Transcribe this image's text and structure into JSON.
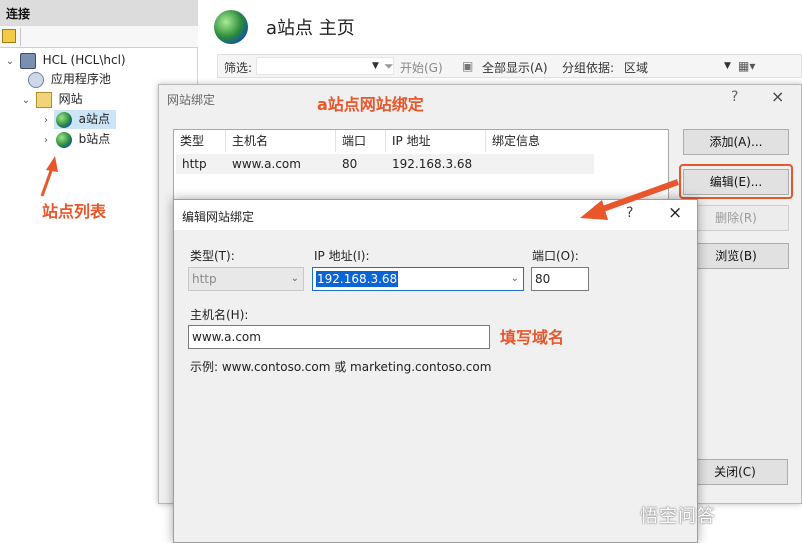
{
  "left_pane": {
    "header": "连接",
    "tree": [
      {
        "label": "HCL (HCL\\hcl)",
        "icon": "server-icon"
      },
      {
        "label": "应用程序池",
        "icon": "app-pool-icon"
      },
      {
        "label": "网站",
        "icon": "sites-folder-icon"
      },
      {
        "label": "a站点",
        "icon": "globe-icon",
        "selected": true
      },
      {
        "label": "b站点",
        "icon": "globe-icon"
      }
    ],
    "annotation": "站点列表"
  },
  "main": {
    "title": "a站点 主页",
    "filter_bar": {
      "filter_label": "筛选:",
      "start_label": "开始(G)",
      "show_all_label": "全部显示(A)",
      "group_by_label": "分组依据:",
      "group_by_value": "区域"
    }
  },
  "bindings_dialog": {
    "title": "网站绑定",
    "annotation": "a站点网站绑定",
    "help": "?",
    "close": "×",
    "columns": [
      "类型",
      "主机名",
      "端口",
      "IP 地址",
      "绑定信息"
    ],
    "rows": [
      {
        "type": "http",
        "host": "www.a.com",
        "port": "80",
        "ip": "192.168.3.68",
        "info": ""
      }
    ],
    "buttons": {
      "add": "添加(A)...",
      "edit": "编辑(E)...",
      "remove": "删除(R)",
      "browse": "浏览(B)",
      "close": "关闭(C)"
    }
  },
  "edit_dialog": {
    "title": "编辑网站绑定",
    "help": "?",
    "close": "×",
    "type_label": "类型(T):",
    "type_value": "http",
    "ip_label": "IP 地址(I):",
    "ip_value": "192.168.3.68",
    "port_label": "端口(O):",
    "port_value": "80",
    "host_label": "主机名(H):",
    "host_value": "www.a.com",
    "example": "示例: www.contoso.com 或 marketing.contoso.com",
    "annotation": "填写域名"
  },
  "watermark": "悟空问答",
  "colors": {
    "annotation": "#e8562c",
    "selection": "#0a64d6",
    "tree_selected": "#cce4f7"
  }
}
